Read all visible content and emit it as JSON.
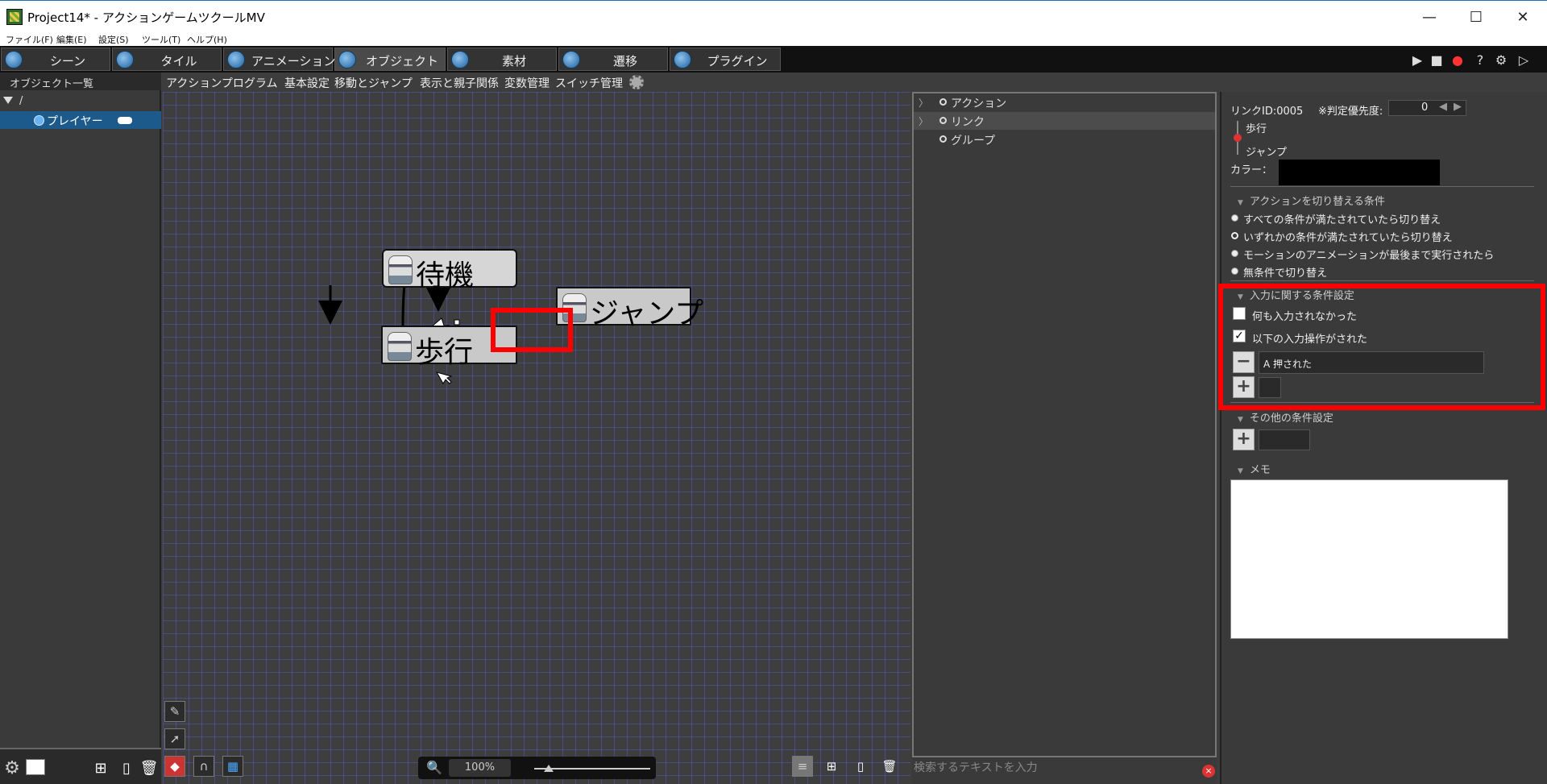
{
  "window": {
    "title": "Project14* - アクションゲームツクールMV",
    "minimize": "—",
    "maximize": "☐",
    "close": "✕"
  },
  "menu": [
    "ファイル(F)",
    "編集(E)",
    "設定(S)",
    "ツール(T)",
    "ヘルプ(H)"
  ],
  "tabs": [
    "シーン",
    "タイル",
    "アニメーション",
    "オブジェクト",
    "素材",
    "遷移",
    "プラグイン"
  ],
  "left_panel": {
    "header": "オブジェクト一覧",
    "root": "/",
    "selected_item": "プレイヤー"
  },
  "sub_tabs": [
    "アクションプログラム",
    "基本設定",
    "移動とジャンプ",
    "表示と親子関係",
    "変数管理",
    "スイッチ管理"
  ],
  "nodes": {
    "idle": "待機",
    "walk": "歩行",
    "jump": "ジャンプ"
  },
  "zoom": {
    "value": "100%"
  },
  "middle_list": {
    "items": [
      "アクション",
      "リンク",
      "グループ"
    ],
    "search_placeholder": "検索するテキストを入力",
    "clear": "×"
  },
  "properties": {
    "link_id": "リンクID:0005",
    "priority_label": "※判定優先度:",
    "priority_value": "0",
    "from_action": "歩行",
    "to_action": "ジャンプ",
    "color_label": "カラー：",
    "switch_conditions_header": "アクションを切り替える条件",
    "switch_options": [
      "すべての条件が満たされていたら切り替え",
      "いずれかの条件が満たされていたら切り替え",
      "モーションのアニメーションが最後まで実行されたら",
      "無条件で切り替え"
    ],
    "selected_switch_option": 1,
    "input_conditions_header": "入力に関する条件設定",
    "no_input_label": "何も入力されなかった",
    "no_input_checked": false,
    "input_performed_label": "以下の入力操作がされた",
    "input_performed_checked": true,
    "input_entry": "A 押された",
    "other_conditions_header": "その他の条件設定",
    "memo_header": "メモ"
  },
  "colors": {
    "highlight": "#ff0000",
    "selected_item_bg": "#1d5a8c",
    "grid": "#505abe"
  }
}
